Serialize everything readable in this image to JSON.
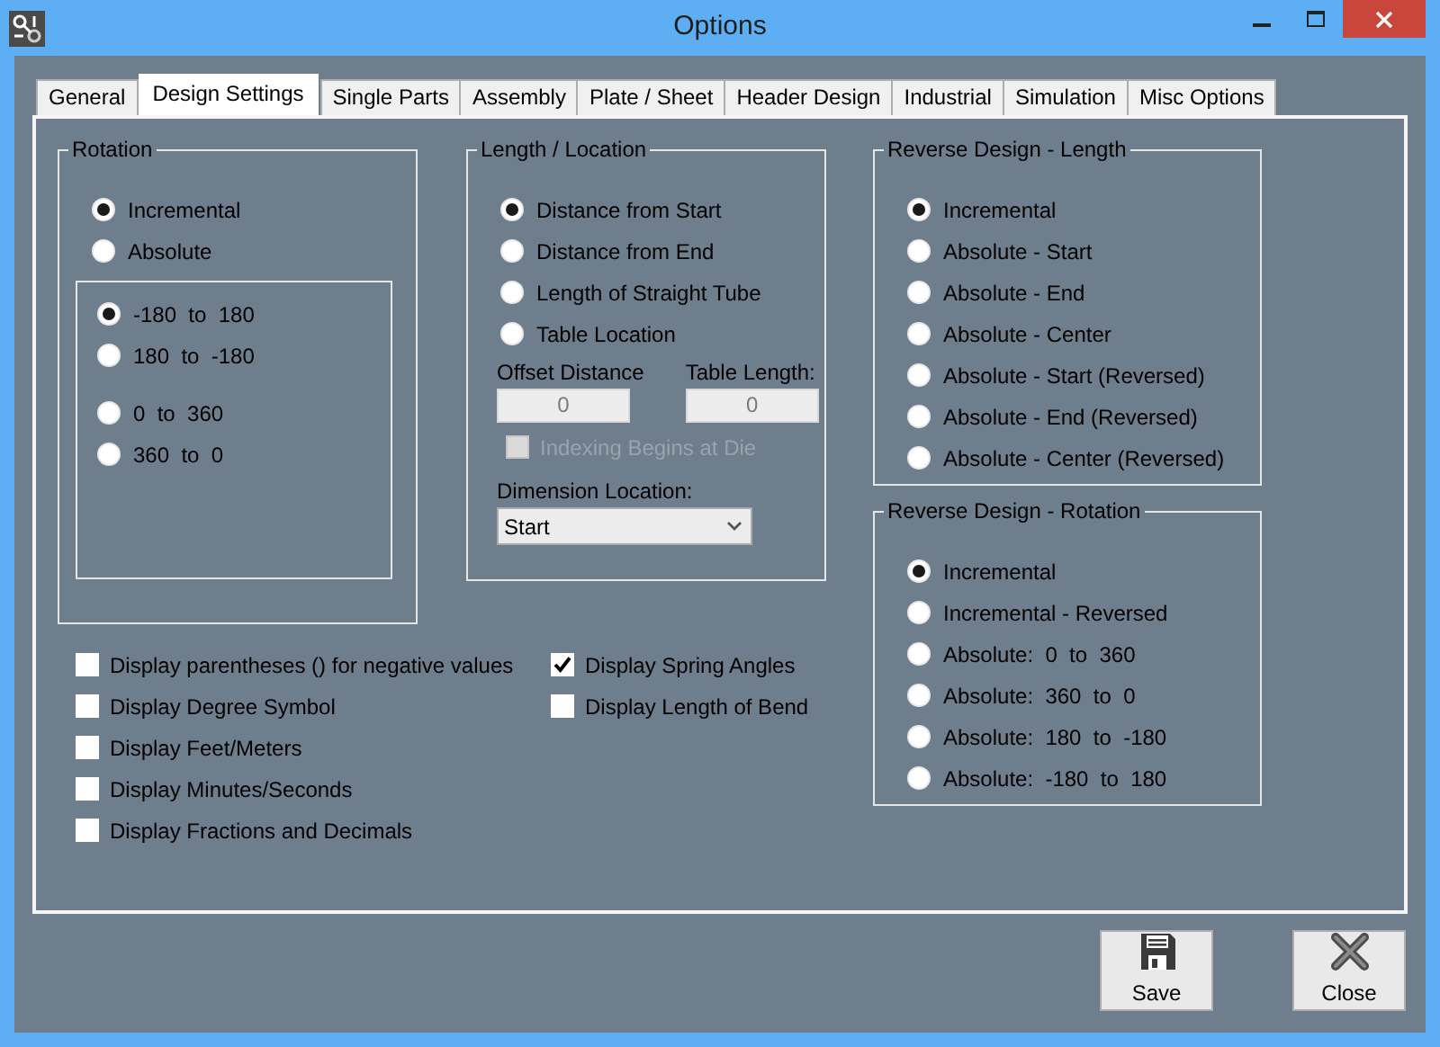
{
  "window": {
    "title": "Options"
  },
  "tabs": [
    {
      "label": "General",
      "selected": false
    },
    {
      "label": "Design Settings",
      "selected": true
    },
    {
      "label": "Single Parts",
      "selected": false
    },
    {
      "label": "Assembly",
      "selected": false
    },
    {
      "label": "Plate / Sheet",
      "selected": false
    },
    {
      "label": "Header Design",
      "selected": false
    },
    {
      "label": "Industrial",
      "selected": false
    },
    {
      "label": "Simulation",
      "selected": false
    },
    {
      "label": "Misc Options",
      "selected": false
    }
  ],
  "rotation": {
    "title": "Rotation",
    "options": [
      {
        "label": "Incremental",
        "selected": true
      },
      {
        "label": "Absolute",
        "selected": false
      }
    ],
    "ranges": [
      {
        "label": "-180  to  180",
        "selected": true
      },
      {
        "label": "180  to  -180",
        "selected": false
      },
      {
        "label": "0  to  360",
        "selected": false
      },
      {
        "label": "360  to  0",
        "selected": false
      }
    ]
  },
  "length_location": {
    "title": "Length / Location",
    "options": [
      {
        "label": "Distance from Start",
        "selected": true
      },
      {
        "label": "Distance from End",
        "selected": false
      },
      {
        "label": "Length of Straight Tube",
        "selected": false
      },
      {
        "label": "Table Location",
        "selected": false
      }
    ],
    "offset_distance": {
      "label": "Offset Distance",
      "value": "0"
    },
    "table_length": {
      "label": "Table Length:",
      "value": "0"
    },
    "indexing": {
      "label": "Indexing Begins at Die",
      "checked": false,
      "disabled": true
    },
    "dimension_location": {
      "label": "Dimension Location:",
      "value": "Start"
    }
  },
  "reverse_length": {
    "title": "Reverse Design - Length",
    "options": [
      {
        "label": "Incremental",
        "selected": true
      },
      {
        "label": "Absolute - Start",
        "selected": false
      },
      {
        "label": "Absolute - End",
        "selected": false
      },
      {
        "label": "Absolute - Center",
        "selected": false
      },
      {
        "label": "Absolute - Start (Reversed)",
        "selected": false
      },
      {
        "label": "Absolute - End (Reversed)",
        "selected": false
      },
      {
        "label": "Absolute - Center (Reversed)",
        "selected": false
      }
    ]
  },
  "reverse_rotation": {
    "title": "Reverse Design - Rotation",
    "options": [
      {
        "label": "Incremental",
        "selected": true
      },
      {
        "label": "Incremental - Reversed",
        "selected": false
      },
      {
        "label": "Absolute:  0  to  360",
        "selected": false
      },
      {
        "label": "Absolute:  360  to  0",
        "selected": false
      },
      {
        "label": "Absolute:  180  to  -180",
        "selected": false
      },
      {
        "label": "Absolute:  -180  to  180",
        "selected": false
      }
    ]
  },
  "display_options": [
    [
      {
        "label": "Display parentheses () for negative values",
        "checked": false
      },
      {
        "label": "Display Degree Symbol",
        "checked": false
      },
      {
        "label": "Display Feet/Meters",
        "checked": false
      },
      {
        "label": "Display Minutes/Seconds",
        "checked": false
      },
      {
        "label": "Display Fractions and Decimals",
        "checked": false
      }
    ],
    [
      {
        "label": "Display Spring Angles",
        "checked": true
      },
      {
        "label": "Display Length of Bend",
        "checked": false
      }
    ]
  ],
  "buttons": [
    {
      "label": "Save",
      "kind": "save"
    },
    {
      "label": "Close",
      "kind": "close"
    }
  ]
}
